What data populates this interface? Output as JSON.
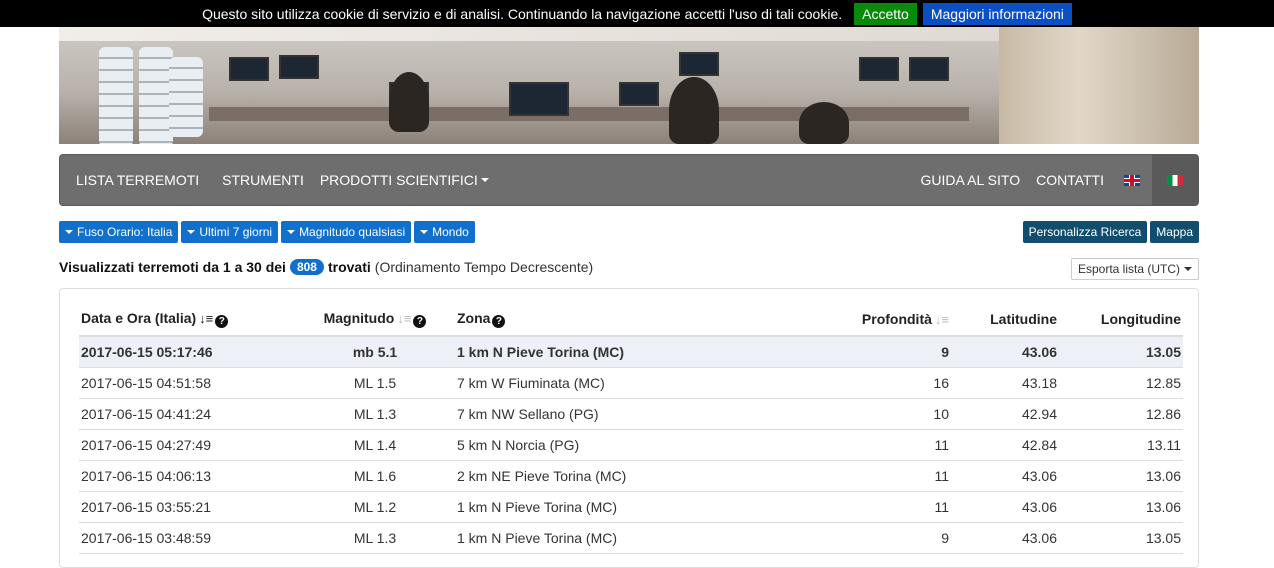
{
  "cookie": {
    "message": "Questo sito utilizza cookie di servizio e di analisi. Continuando la navigazione accetti l'uso di tali cookie.",
    "accept_label": "Accetto",
    "more_label": "Maggiori informazioni"
  },
  "nav": {
    "left": [
      "LISTA TERREMOTI",
      "STRUMENTI",
      "PRODOTTI SCIENTIFICI"
    ],
    "right": [
      "GUIDA AL SITO",
      "CONTATTI"
    ]
  },
  "filters": [
    "Fuso Orario: Italia",
    "Ultimi 7 giorni",
    "Magnitudo qualsiasi",
    "Mondo"
  ],
  "actions": {
    "customize": "Personalizza Ricerca",
    "map": "Mappa"
  },
  "summary": {
    "prefix": "Visualizzati terremoti da 1 a 30 dei",
    "count": "808",
    "suffix": "trovati",
    "sort": "(Ordinamento Tempo Decrescente)"
  },
  "export_label": "Esporta lista (UTC)",
  "table": {
    "headers": {
      "date": "Data e Ora (Italia)",
      "magnitude": "Magnitudo",
      "zone": "Zona",
      "depth": "Profondità",
      "lat": "Latitudine",
      "lon": "Longitudine"
    },
    "rows": [
      [
        "2017-06-15 05:17:46",
        "mb 5.1",
        "1 km N Pieve Torina (MC)",
        "9",
        "43.06",
        "13.05"
      ],
      [
        "2017-06-15 04:51:58",
        "ML 1.5",
        "7 km W Fiuminata (MC)",
        "16",
        "43.18",
        "12.85"
      ],
      [
        "2017-06-15 04:41:24",
        "ML 1.3",
        "7 km NW Sellano (PG)",
        "10",
        "42.94",
        "12.86"
      ],
      [
        "2017-06-15 04:27:49",
        "ML 1.4",
        "5 km N Norcia (PG)",
        "11",
        "42.84",
        "13.11"
      ],
      [
        "2017-06-15 04:06:13",
        "ML 1.6",
        "2 km NE Pieve Torina (MC)",
        "11",
        "43.06",
        "13.06"
      ],
      [
        "2017-06-15 03:55:21",
        "ML 1.2",
        "1 km N Pieve Torina (MC)",
        "11",
        "43.06",
        "13.06"
      ],
      [
        "2017-06-15 03:48:59",
        "ML 1.3",
        "1 km N Pieve Torina (MC)",
        "9",
        "43.06",
        "13.05"
      ]
    ]
  }
}
